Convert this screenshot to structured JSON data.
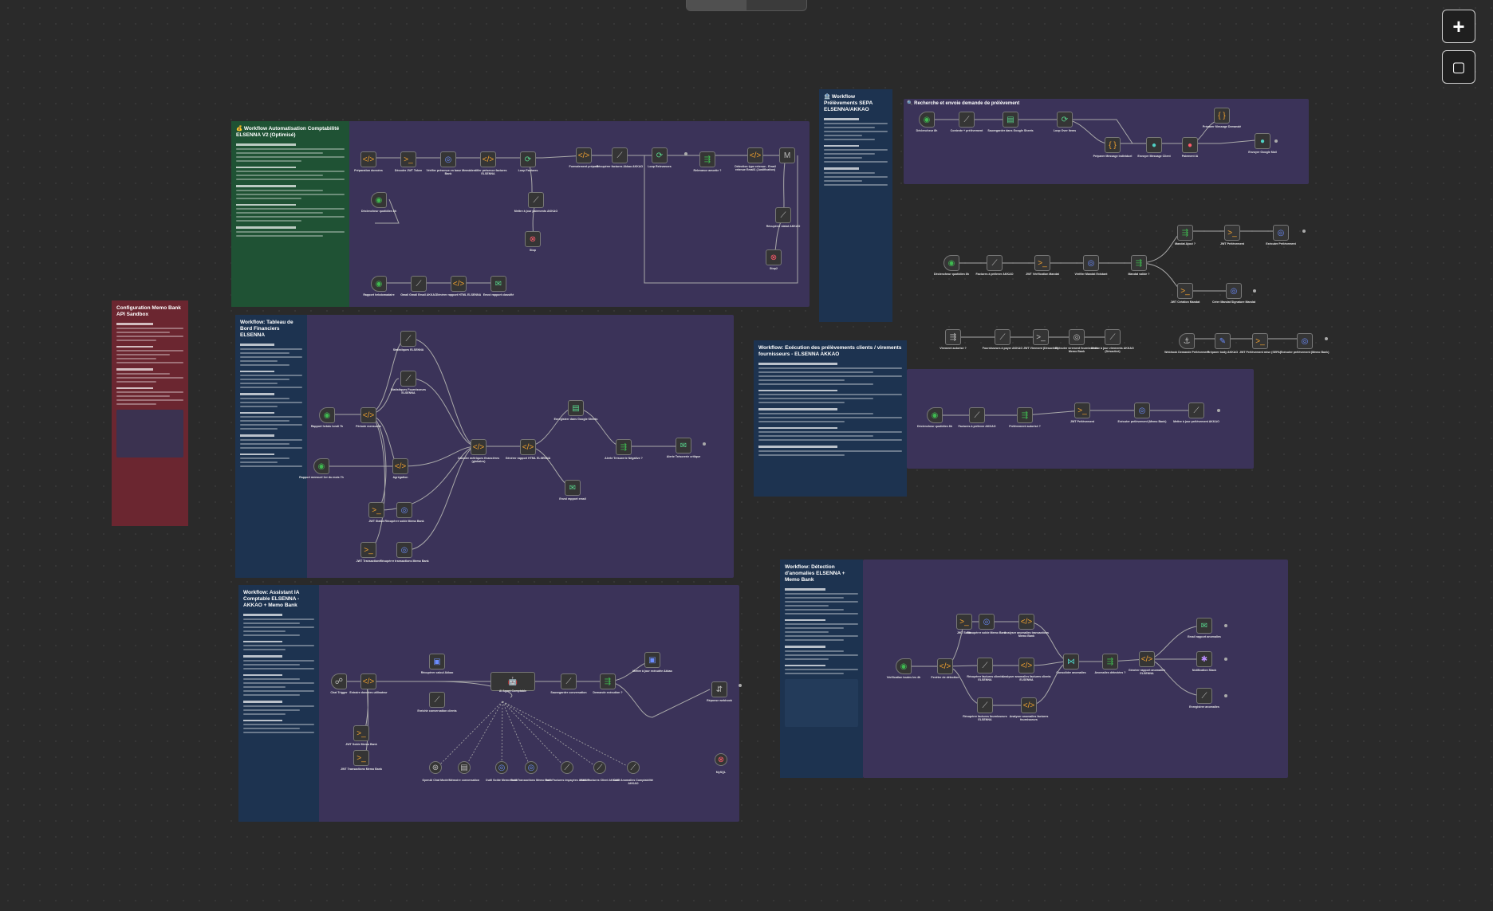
{
  "topbar": {
    "tabs": [
      "",
      ""
    ]
  },
  "toolbar": {
    "add_label": "+",
    "note_label": "▢"
  },
  "groups": [
    {
      "id": "g1",
      "sticky_title": "💰 Workflow Automatisation Comptabilité ELSENNA V2 (Optimisé)",
      "color": "green"
    },
    {
      "id": "g2",
      "sticky_title": "Workflow: Tableau de Bord Financiers ELSENNA",
      "color": "blue"
    },
    {
      "id": "g3",
      "sticky_title": "Workflow: Assistant IA Comptable ELSENNA - AKKAO + Memo Bank",
      "color": "blue"
    },
    {
      "id": "g4",
      "sticky_title": "🏦 Workflow Prélèvements SEPA ELSENNA/AKKAO",
      "color": "blue"
    },
    {
      "id": "g5",
      "sticky_title": "Workflow: Exécution des prélèvements clients / virements fournisseurs - ELSENNA AKKAO",
      "color": "blue"
    },
    {
      "id": "g6",
      "sticky_title": "Workflow: Détection d'anomalies ELSENNA + Memo Bank",
      "color": "blue"
    },
    {
      "id": "g7",
      "sticky_title": "Configuration Memo Bank API Sandbox",
      "color": "red"
    },
    {
      "id": "g8",
      "sticky_title": "🔍 Recherche et envoie demande de prélèvement",
      "color": "none"
    }
  ],
  "nodes": {
    "n1": "Préparation données",
    "n2": "Décoder JWT Token",
    "n3": "Vérifier présence en base Memo Bank",
    "n4": "Identifier présence factures ELSENNA",
    "n5": "Loop Factures",
    "n6": "Formatement préparé",
    "n7": "Récupérer factures Akkao AKKAO",
    "n8": "Loop Relevances",
    "n9": "Relevance amortie ?",
    "n10": "Détection type retenue - Email retenue Email1 (Justification)",
    "n11": "Déclencheur quotidien 8h",
    "n12": "Rapport hebdomadaire",
    "n13": "Gmail Gmail Email AKKAO",
    "n14": "Générer rapport HTML ELSENNA",
    "n15": "Envoi rapport classifié",
    "n16": "Mettre à jour paiements AKKAO",
    "n17": "Stop",
    "n18": "Récupérer statut AKKAO",
    "n19": "Stop2",
    "n20": "Rapport hebdo lundi 7h",
    "n21": "Période mensuelle",
    "n22": "Statistiques ELSENNA",
    "n23": "Statistiques Fournisseurs ELSENNA",
    "n24": "Rapport mensuel 1er du mois 7h",
    "n25": "Agrégation",
    "n26": "JWT Stable",
    "n27": "Récupérer solde Memo Bank",
    "n28": "JWT Transactions",
    "n29": "Récupérer transactions Memo Bank",
    "n30": "Calculer métriques financières (globales)",
    "n31": "Générer rapport HTML ELSENNA",
    "n32": "Enregistrer dans Google Sheets",
    "n33": "Envoi rapport email",
    "n34": "Alerte Trésorerie Négative ?",
    "n35": "Alerte Trésorerie critique",
    "n36": "Chat Trigger",
    "n37": "Extraire données utilisateur",
    "n38": "Récupérer calcul Akkao",
    "n39": "Enrichir conversation clients",
    "n40": "AI Agent Comptable",
    "n41": "Sauvegarder conversation",
    "n42": "Demande exécution ?",
    "n43": "Mettre à jour exécutée Akkao",
    "n44": "Réponse webhook",
    "n45": "JWT Solde Memo Bank",
    "n46": "JWT Transactions Memo Bank",
    "n47": "OpenAI Chat Model",
    "n48": "Mémoire conversation",
    "n49": "Outil Solde Memo Bank",
    "n50": "Outil Transactions Memo Bank",
    "n51": "Outil Factures impayées AKKAO",
    "n52": "Outil Factures Client AKKAO",
    "n53": "Outil Anomalies Comptabilité AKKAO",
    "n54": "MySQL",
    "n55": "Déclencheur 8h",
    "n56": "Contexte + prélèvement",
    "n57": "Sauvegarder dans Google Sheets",
    "n58": "Loop Over Items",
    "n59": "Préparer Message individuel",
    "n60": "Envoyer Message Client",
    "n61": "Paiement IA",
    "n62": "Préparer Message Demandé",
    "n63": "Envoyer Google Mail",
    "n64": "Déclencheur quotidien 8h",
    "n65": "Factures à prélever AKKAO",
    "n66": "JWT Vérification Mandat",
    "n67": "Vérifier Mandat Existant",
    "n68": "Mandat valide ?",
    "n69": "Mandat Ajout ?",
    "n70": "JWT Prélèvement",
    "n71": "Exécuter Prélèvement",
    "n72": "JWT Création Mandat",
    "n73": "Créer Mandat Signature Mandat",
    "n74": "Virement autorisé ?",
    "n75": "Fournisseurs à payer AKKAO",
    "n76": "JWT Virement (Désactivé)",
    "n77": "Exécuter virement fournisseurs Memo Bank",
    "n78": "Mettre à jour virements AKKAO (Désactivé)",
    "n79": "Webhook Demande Prélèvement",
    "n80": "Préparer body AKKAO",
    "n81": "JWT Prélèvement mise (SEPA)",
    "n82": "Exécuter prélèvement (Memo Bank)",
    "n83": "Déclencheur quotidien 8h",
    "n84": "Factures à prélever AKKAO",
    "n85": "Prélèvement autorisé ?",
    "n86": "JWT Prélèvement",
    "n87": "Exécuter prélèvement (Memo Bank)",
    "n88": "Mettre à jour prélèvement AKKAO",
    "n89": "Vérification toutes les 4h",
    "n90": "Fenêtre de détection",
    "n91": "JWT Solde",
    "n92": "Récupérer solde Memo Bank",
    "n93": "Analyser anomalies transactions Memo Bank",
    "n94": "Récupérer factures clients ELSENNA",
    "n95": "Analyser anomalies factures clients ELSENNA",
    "n96": "Récupérer factures fournisseurs ELSENNA",
    "n97": "Analyser anomalies factures fournisseurs",
    "n98": "Consolider anomalies",
    "n99": "Anomalies détectées ?",
    "n100": "Générer rapport anomalies ELSENNA",
    "n101": "Email rapport anomalies",
    "n102": "Notification Slack",
    "n103": "Enregistrer anomalies",
    "n104": "Aucune anomalie"
  }
}
